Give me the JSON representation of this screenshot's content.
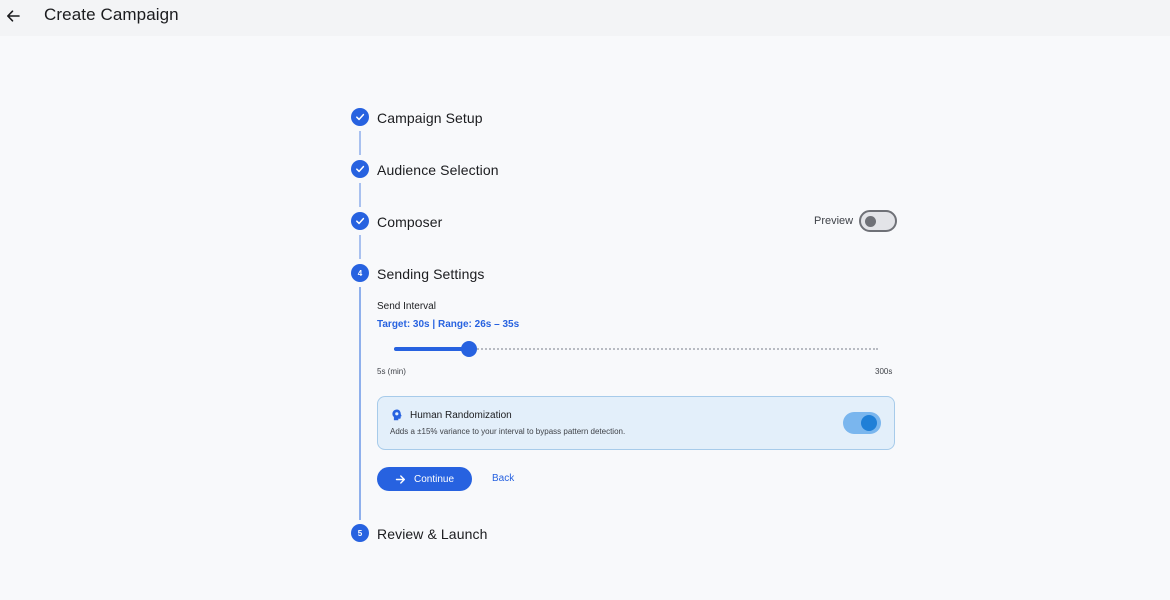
{
  "header": {
    "title": "Create Campaign",
    "back_icon": "arrow-left-icon"
  },
  "steps": [
    {
      "label": "Campaign Setup",
      "status": "completed",
      "marker": ""
    },
    {
      "label": "Audience Selection",
      "status": "completed",
      "marker": ""
    },
    {
      "label": "Composer",
      "status": "completed",
      "marker": ""
    },
    {
      "label": "Sending Settings",
      "status": "active",
      "marker": "4"
    },
    {
      "label": "Review & Launch",
      "status": "pending",
      "marker": "5"
    }
  ],
  "composer": {
    "preview_label": "Preview",
    "preview_enabled": false
  },
  "sending": {
    "interval_label": "Send Interval",
    "target_summary": "Target: 30s  |  Range: 26s – 35s",
    "slider": {
      "min": 5,
      "max": 300,
      "value": 30,
      "min_label": "5s (min)",
      "max_label": "300s"
    },
    "randomization": {
      "title": "Human Randomization",
      "description": "Adds a ±15% variance to your interval to bypass pattern detection.",
      "icon": "psychology-head-icon",
      "enabled": true
    },
    "continue_label": "Continue",
    "back_label": "Back"
  },
  "colors": {
    "primary": "#2762e0",
    "card_bg": "#e3effa",
    "card_border": "#a7cbea",
    "toggle_on_track": "#7ab6ee",
    "toggle_on_knob": "#1f7fd7"
  }
}
